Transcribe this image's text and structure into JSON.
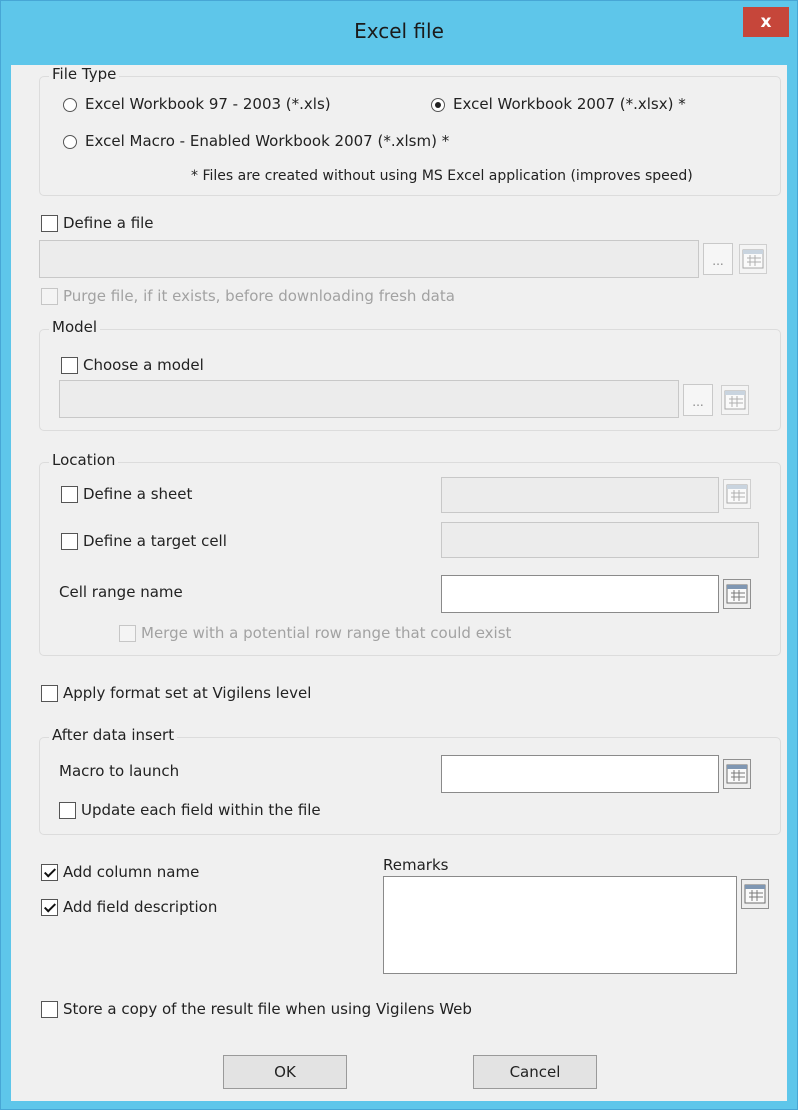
{
  "window": {
    "title": "Excel file",
    "close_glyph": "x"
  },
  "file_type": {
    "legend": "File Type",
    "options": [
      {
        "label": "Excel Workbook 97 - 2003 (*.xls)",
        "selected": false
      },
      {
        "label": "Excel Workbook 2007 (*.xlsx) *",
        "selected": true
      },
      {
        "label": "Excel Macro - Enabled Workbook 2007 (*.xlsm) *",
        "selected": false
      }
    ],
    "note": "* Files are created without using MS Excel application (improves speed)"
  },
  "define_file": {
    "label": "Define a file",
    "checked": false,
    "path_value": "",
    "browse_label": "...",
    "purge_label": "Purge file, if it exists, before downloading fresh data"
  },
  "model": {
    "legend": "Model",
    "choose_label": "Choose a model",
    "checked": false,
    "path_value": "",
    "browse_label": "..."
  },
  "location": {
    "legend": "Location",
    "sheet_label": "Define a sheet",
    "target_cell_label": "Define a target cell",
    "cell_range_label": "Cell range name",
    "cell_range_value": "",
    "merge_label": "Merge with a potential row range that could exist"
  },
  "apply_format": {
    "label": "Apply format set at Vigilens level",
    "checked": false
  },
  "after_insert": {
    "legend": "After data insert",
    "macro_label": "Macro to launch",
    "macro_value": "",
    "update_label": "Update each field within the file",
    "update_checked": false
  },
  "options": {
    "add_column_name": {
      "label": "Add column name",
      "checked": true
    },
    "add_field_description": {
      "label": "Add field description",
      "checked": true
    }
  },
  "remarks": {
    "label": "Remarks",
    "value": ""
  },
  "store_copy": {
    "label": "Store a copy of the result file when using Vigilens Web",
    "checked": false
  },
  "buttons": {
    "ok": "OK",
    "cancel": "Cancel"
  },
  "icons": {
    "calendar": "sheet-calendar-icon",
    "accent": "#5ec6ea",
    "close_bg": "#c6463a"
  }
}
